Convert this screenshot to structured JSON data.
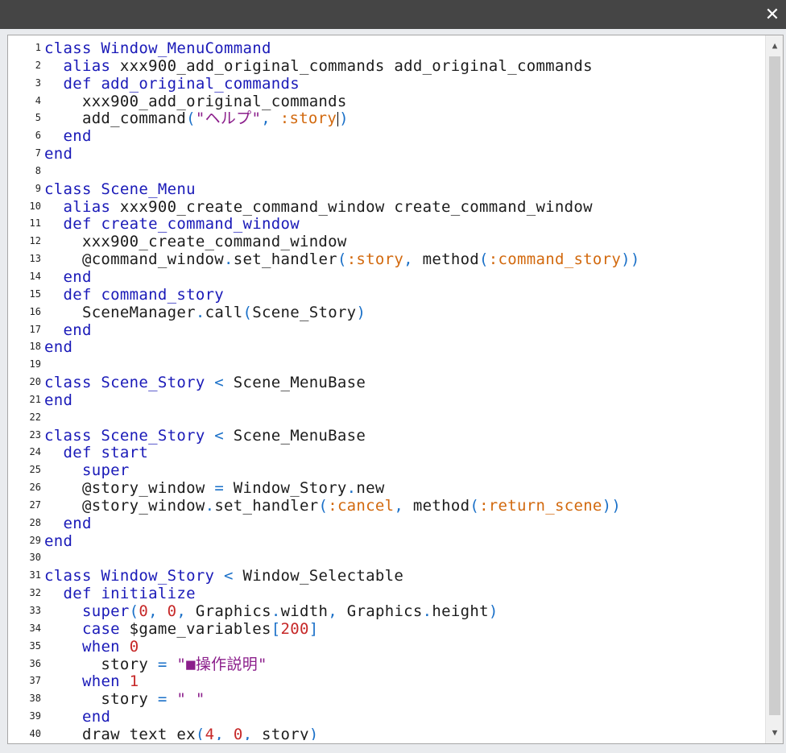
{
  "window": {
    "close_glyph": "✕"
  },
  "scrollbar": {
    "up_glyph": "▲",
    "down_glyph": "▼"
  },
  "colors": {
    "keyword": "#1a1ab8",
    "symbol": "#d2690e",
    "number": "#c62828",
    "string": "#8b1e8b",
    "punctuation": "#1a70c8",
    "text": "#1c1c1c"
  },
  "editor": {
    "cursor_line": 5,
    "lines": [
      {
        "n": "1",
        "tokens": [
          [
            "kw",
            "class Window_MenuCommand"
          ]
        ]
      },
      {
        "n": "2",
        "tokens": [
          [
            "t",
            "  "
          ],
          [
            "kw",
            "alias"
          ],
          [
            "t",
            " xxx900_add_original_commands add_original_commands"
          ]
        ]
      },
      {
        "n": "3",
        "tokens": [
          [
            "t",
            "  "
          ],
          [
            "kw",
            "def add_original_commands"
          ]
        ]
      },
      {
        "n": "4",
        "tokens": [
          [
            "t",
            "    xxx900_add_original_commands"
          ]
        ]
      },
      {
        "n": "5",
        "tokens": [
          [
            "t",
            "    add_command"
          ],
          [
            "punc",
            "("
          ],
          [
            "str",
            "\"ヘルプ\""
          ],
          [
            "punc",
            ", "
          ],
          [
            "sym",
            ":story"
          ],
          [
            "cur",
            ""
          ],
          [
            "punc",
            ")"
          ]
        ]
      },
      {
        "n": "6",
        "tokens": [
          [
            "t",
            "  "
          ],
          [
            "kw",
            "end"
          ]
        ]
      },
      {
        "n": "7",
        "tokens": [
          [
            "kw",
            "end"
          ]
        ]
      },
      {
        "n": "8",
        "tokens": []
      },
      {
        "n": "9",
        "tokens": [
          [
            "kw",
            "class Scene_Menu"
          ]
        ]
      },
      {
        "n": "10",
        "tokens": [
          [
            "t",
            "  "
          ],
          [
            "kw",
            "alias"
          ],
          [
            "t",
            " xxx900_create_command_window create_command_window"
          ]
        ]
      },
      {
        "n": "11",
        "tokens": [
          [
            "t",
            "  "
          ],
          [
            "kw",
            "def create_command_window"
          ]
        ]
      },
      {
        "n": "12",
        "tokens": [
          [
            "t",
            "    xxx900_create_command_window"
          ]
        ]
      },
      {
        "n": "13",
        "tokens": [
          [
            "t",
            "    @command_window"
          ],
          [
            "punc",
            "."
          ],
          [
            "t",
            "set_handler"
          ],
          [
            "punc",
            "("
          ],
          [
            "sym",
            ":story"
          ],
          [
            "punc",
            ", "
          ],
          [
            "t",
            "method"
          ],
          [
            "punc",
            "("
          ],
          [
            "sym",
            ":command_story"
          ],
          [
            "punc",
            "))"
          ]
        ]
      },
      {
        "n": "14",
        "tokens": [
          [
            "t",
            "  "
          ],
          [
            "kw",
            "end"
          ]
        ]
      },
      {
        "n": "15",
        "tokens": [
          [
            "t",
            "  "
          ],
          [
            "kw",
            "def command_story"
          ]
        ]
      },
      {
        "n": "16",
        "tokens": [
          [
            "t",
            "    SceneManager"
          ],
          [
            "punc",
            "."
          ],
          [
            "t",
            "call"
          ],
          [
            "punc",
            "("
          ],
          [
            "t",
            "Scene_Story"
          ],
          [
            "punc",
            ")"
          ]
        ]
      },
      {
        "n": "17",
        "tokens": [
          [
            "t",
            "  "
          ],
          [
            "kw",
            "end"
          ]
        ]
      },
      {
        "n": "18",
        "tokens": [
          [
            "kw",
            "end"
          ]
        ]
      },
      {
        "n": "19",
        "tokens": []
      },
      {
        "n": "20",
        "tokens": [
          [
            "kw",
            "class Scene_Story"
          ],
          [
            "punc",
            " < "
          ],
          [
            "t",
            "Scene_MenuBase"
          ]
        ]
      },
      {
        "n": "21",
        "tokens": [
          [
            "kw",
            "end"
          ]
        ]
      },
      {
        "n": "22",
        "tokens": []
      },
      {
        "n": "23",
        "tokens": [
          [
            "kw",
            "class Scene_Story"
          ],
          [
            "punc",
            " < "
          ],
          [
            "t",
            "Scene_MenuBase"
          ]
        ]
      },
      {
        "n": "24",
        "tokens": [
          [
            "t",
            "  "
          ],
          [
            "kw",
            "def start"
          ]
        ]
      },
      {
        "n": "25",
        "tokens": [
          [
            "t",
            "    "
          ],
          [
            "kw",
            "super"
          ]
        ]
      },
      {
        "n": "26",
        "tokens": [
          [
            "t",
            "    @story_window "
          ],
          [
            "punc",
            "="
          ],
          [
            "t",
            " Window_Story"
          ],
          [
            "punc",
            "."
          ],
          [
            "t",
            "new"
          ]
        ]
      },
      {
        "n": "27",
        "tokens": [
          [
            "t",
            "    @story_window"
          ],
          [
            "punc",
            "."
          ],
          [
            "t",
            "set_handler"
          ],
          [
            "punc",
            "("
          ],
          [
            "sym",
            ":cancel"
          ],
          [
            "punc",
            ", "
          ],
          [
            "t",
            "method"
          ],
          [
            "punc",
            "("
          ],
          [
            "sym",
            ":return_scene"
          ],
          [
            "punc",
            "))"
          ]
        ]
      },
      {
        "n": "28",
        "tokens": [
          [
            "t",
            "  "
          ],
          [
            "kw",
            "end"
          ]
        ]
      },
      {
        "n": "29",
        "tokens": [
          [
            "kw",
            "end"
          ]
        ]
      },
      {
        "n": "30",
        "tokens": []
      },
      {
        "n": "31",
        "tokens": [
          [
            "kw",
            "class Window_Story"
          ],
          [
            "punc",
            " < "
          ],
          [
            "t",
            "Window_Selectable"
          ]
        ]
      },
      {
        "n": "32",
        "tokens": [
          [
            "t",
            "  "
          ],
          [
            "kw",
            "def initialize"
          ]
        ]
      },
      {
        "n": "33",
        "tokens": [
          [
            "t",
            "    "
          ],
          [
            "kw",
            "super"
          ],
          [
            "punc",
            "("
          ],
          [
            "num",
            "0"
          ],
          [
            "punc",
            ", "
          ],
          [
            "num",
            "0"
          ],
          [
            "punc",
            ", "
          ],
          [
            "t",
            "Graphics"
          ],
          [
            "punc",
            "."
          ],
          [
            "t",
            "width"
          ],
          [
            "punc",
            ", "
          ],
          [
            "t",
            "Graphics"
          ],
          [
            "punc",
            "."
          ],
          [
            "t",
            "height"
          ],
          [
            "punc",
            ")"
          ]
        ]
      },
      {
        "n": "34",
        "tokens": [
          [
            "t",
            "    "
          ],
          [
            "kw",
            "case"
          ],
          [
            "t",
            " $game_variables"
          ],
          [
            "punc",
            "["
          ],
          [
            "num",
            "200"
          ],
          [
            "punc",
            "]"
          ]
        ]
      },
      {
        "n": "35",
        "tokens": [
          [
            "t",
            "    "
          ],
          [
            "kw",
            "when"
          ],
          [
            "t",
            " "
          ],
          [
            "num",
            "0"
          ]
        ]
      },
      {
        "n": "36",
        "tokens": [
          [
            "t",
            "      story "
          ],
          [
            "punc",
            "="
          ],
          [
            "t",
            " "
          ],
          [
            "str",
            "\"■操作説明\""
          ]
        ]
      },
      {
        "n": "37",
        "tokens": [
          [
            "t",
            "    "
          ],
          [
            "kw",
            "when"
          ],
          [
            "t",
            " "
          ],
          [
            "num",
            "1"
          ]
        ]
      },
      {
        "n": "38",
        "tokens": [
          [
            "t",
            "      story "
          ],
          [
            "punc",
            "="
          ],
          [
            "t",
            " "
          ],
          [
            "str",
            "\" \""
          ]
        ]
      },
      {
        "n": "39",
        "tokens": [
          [
            "t",
            "    "
          ],
          [
            "kw",
            "end"
          ]
        ]
      },
      {
        "n": "40",
        "tokens": [
          [
            "t",
            "    draw_text_ex"
          ],
          [
            "punc",
            "("
          ],
          [
            "num",
            "4"
          ],
          [
            "punc",
            ", "
          ],
          [
            "num",
            "0"
          ],
          [
            "punc",
            ", "
          ],
          [
            "t",
            "story"
          ],
          [
            "punc",
            ")"
          ]
        ]
      }
    ]
  }
}
